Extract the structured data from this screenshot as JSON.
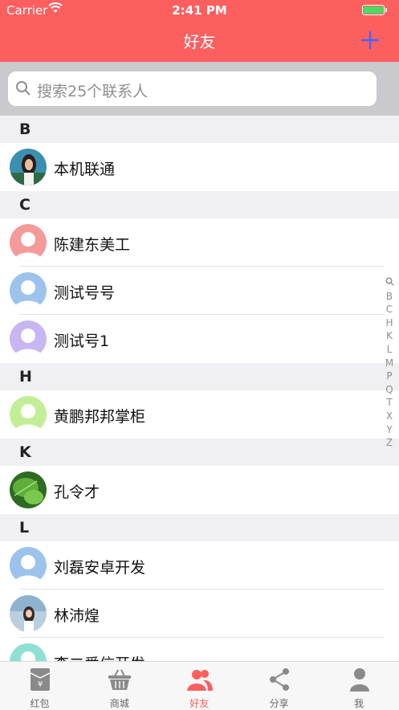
{
  "status_bar": {
    "carrier": "Carrier",
    "time": "2:41 PM"
  },
  "header": {
    "title": "好友",
    "add_icon": "plus-icon",
    "accent": "#fd5f5f"
  },
  "search": {
    "placeholder": "搜索25个联系人"
  },
  "sections": [
    {
      "letter": "B",
      "contacts": [
        {
          "name": "本机联通",
          "avatar": "photo-woman"
        }
      ]
    },
    {
      "letter": "C",
      "contacts": [
        {
          "name": "陈建东美工",
          "avatar": "default-pink"
        },
        {
          "name": "测试号号",
          "avatar": "default-blue"
        },
        {
          "name": "测试号1",
          "avatar": "default-purple"
        }
      ]
    },
    {
      "letter": "H",
      "contacts": [
        {
          "name": "黄鹏邦邦掌柜",
          "avatar": "default-green"
        }
      ]
    },
    {
      "letter": "K",
      "contacts": [
        {
          "name": "孔令才",
          "avatar": "photo-leaf"
        }
      ]
    },
    {
      "letter": "L",
      "contacts": [
        {
          "name": "刘磊安卓开发",
          "avatar": "default-blue"
        },
        {
          "name": "林沛煌",
          "avatar": "photo-girl"
        },
        {
          "name": "李二爱信开发",
          "avatar": "default-teal"
        }
      ]
    }
  ],
  "index_letters": [
    "B",
    "C",
    "H",
    "K",
    "L",
    "M",
    "P",
    "Q",
    "T",
    "X",
    "Y",
    "Z"
  ],
  "tabs": [
    {
      "label": "红包",
      "icon": "red-envelope-icon",
      "active": false
    },
    {
      "label": "商城",
      "icon": "basket-icon",
      "active": false
    },
    {
      "label": "好友",
      "icon": "friends-icon",
      "active": true
    },
    {
      "label": "分享",
      "icon": "share-icon",
      "active": false
    },
    {
      "label": "我",
      "icon": "person-icon",
      "active": false
    }
  ]
}
